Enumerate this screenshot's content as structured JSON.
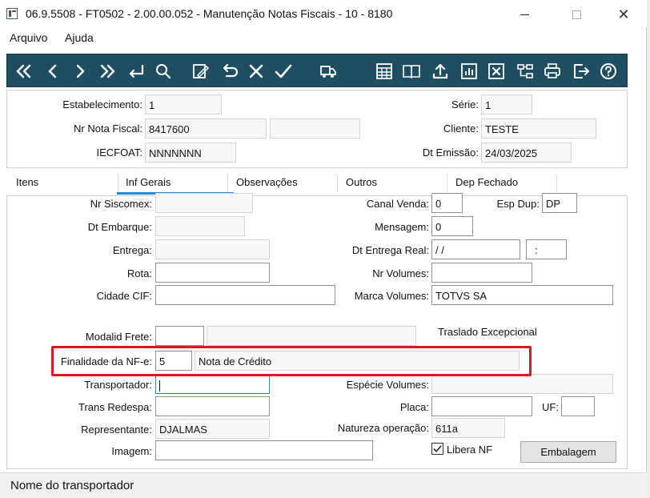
{
  "window": {
    "title": "06.9.5508 - FT0502 - 2.00.00.052 - Manutenção Notas Fiscais - 10 - 8180",
    "minimize_label": "",
    "close_label": "✕"
  },
  "menu": {
    "items": [
      "Arquivo",
      "Ajuda"
    ]
  },
  "toolbar": {
    "icons": [
      "first-icon",
      "previous-icon",
      "next-icon",
      "last-icon",
      "return-icon",
      "search-icon",
      "edit-icon",
      "undo-icon",
      "cancel-icon",
      "confirm-icon",
      "truck-icon",
      "calculator-icon",
      "book-icon",
      "upload-icon",
      "chart-icon",
      "delete-icon",
      "tree-icon",
      "print-icon",
      "exit-icon",
      "help-icon"
    ],
    "accent": "#1d4e62"
  },
  "header": {
    "estabelecimento": {
      "label": "Estabelecimento:",
      "value": "1"
    },
    "nr_nota_fiscal": {
      "label": "Nr Nota Fiscal:",
      "value": "8417600",
      "extra": ""
    },
    "iecfoat": {
      "label": "IECFOAT:",
      "value": "NNNNNNN"
    },
    "serie": {
      "label": "Série:",
      "value": "1"
    },
    "cliente": {
      "label": "Cliente:",
      "value": "TESTE"
    },
    "dt_emissao": {
      "label": "Dt Emissão:",
      "value": "24/03/2025"
    }
  },
  "tabs": {
    "items": [
      "Itens",
      "Inf Gerais",
      "Observações",
      "Outros",
      "Dep Fechado"
    ],
    "active": "Inf Gerais"
  },
  "form": {
    "nr_siscomex": {
      "label": "Nr Siscomex:",
      "value": ""
    },
    "dt_embarque": {
      "label": "Dt Embarque:",
      "value": ""
    },
    "entrega": {
      "label": "Entrega:",
      "value": ""
    },
    "rota": {
      "label": "Rota:",
      "value": ""
    },
    "cidade_cif": {
      "label": "Cidade CIF:",
      "value": ""
    },
    "modalid_frete": {
      "label": "Modalid Frete:",
      "value": "",
      "desc": ""
    },
    "finalidade": {
      "label": "Finalidade da NF-e:",
      "value": "5",
      "desc": "Nota de Crédito"
    },
    "transportador": {
      "label": "Transportador:",
      "value": ""
    },
    "trans_redespa": {
      "label": "Trans Redespa:",
      "value": ""
    },
    "representante": {
      "label": "Representante:",
      "value": "DJALMAS"
    },
    "imagem": {
      "label": "Imagem:",
      "value": ""
    },
    "canal_venda": {
      "label": "Canal Venda:",
      "value": "0"
    },
    "esp_dup": {
      "label": "Esp Dup:",
      "value": "DP"
    },
    "mensagem": {
      "label": "Mensagem:",
      "value": "0"
    },
    "dt_entrega_real": {
      "label": "Dt Entrega Real:",
      "value": " / /",
      "time": ":"
    },
    "nr_volumes": {
      "label": "Nr Volumes:",
      "value": ""
    },
    "marca_volumes": {
      "label": "Marca Volumes:",
      "value": "TOTVS SA"
    },
    "traslado_label": "Traslado Excepcional",
    "especie_volumes": {
      "label": "Espécie Volumes:",
      "value": ""
    },
    "placa": {
      "label": "Placa:",
      "value": ""
    },
    "uf": {
      "label": "UF:",
      "value": ""
    },
    "natureza_operacao": {
      "label": "Natureza operação:",
      "value": "611a"
    },
    "libera_nf": {
      "label": "Libera NF",
      "checked": true
    },
    "embalagem_button": "Embalagem"
  },
  "status": {
    "text": "Nome do transportador"
  },
  "colors": {
    "highlight": "#e3141b",
    "tab_active": "#2a8ad4"
  }
}
